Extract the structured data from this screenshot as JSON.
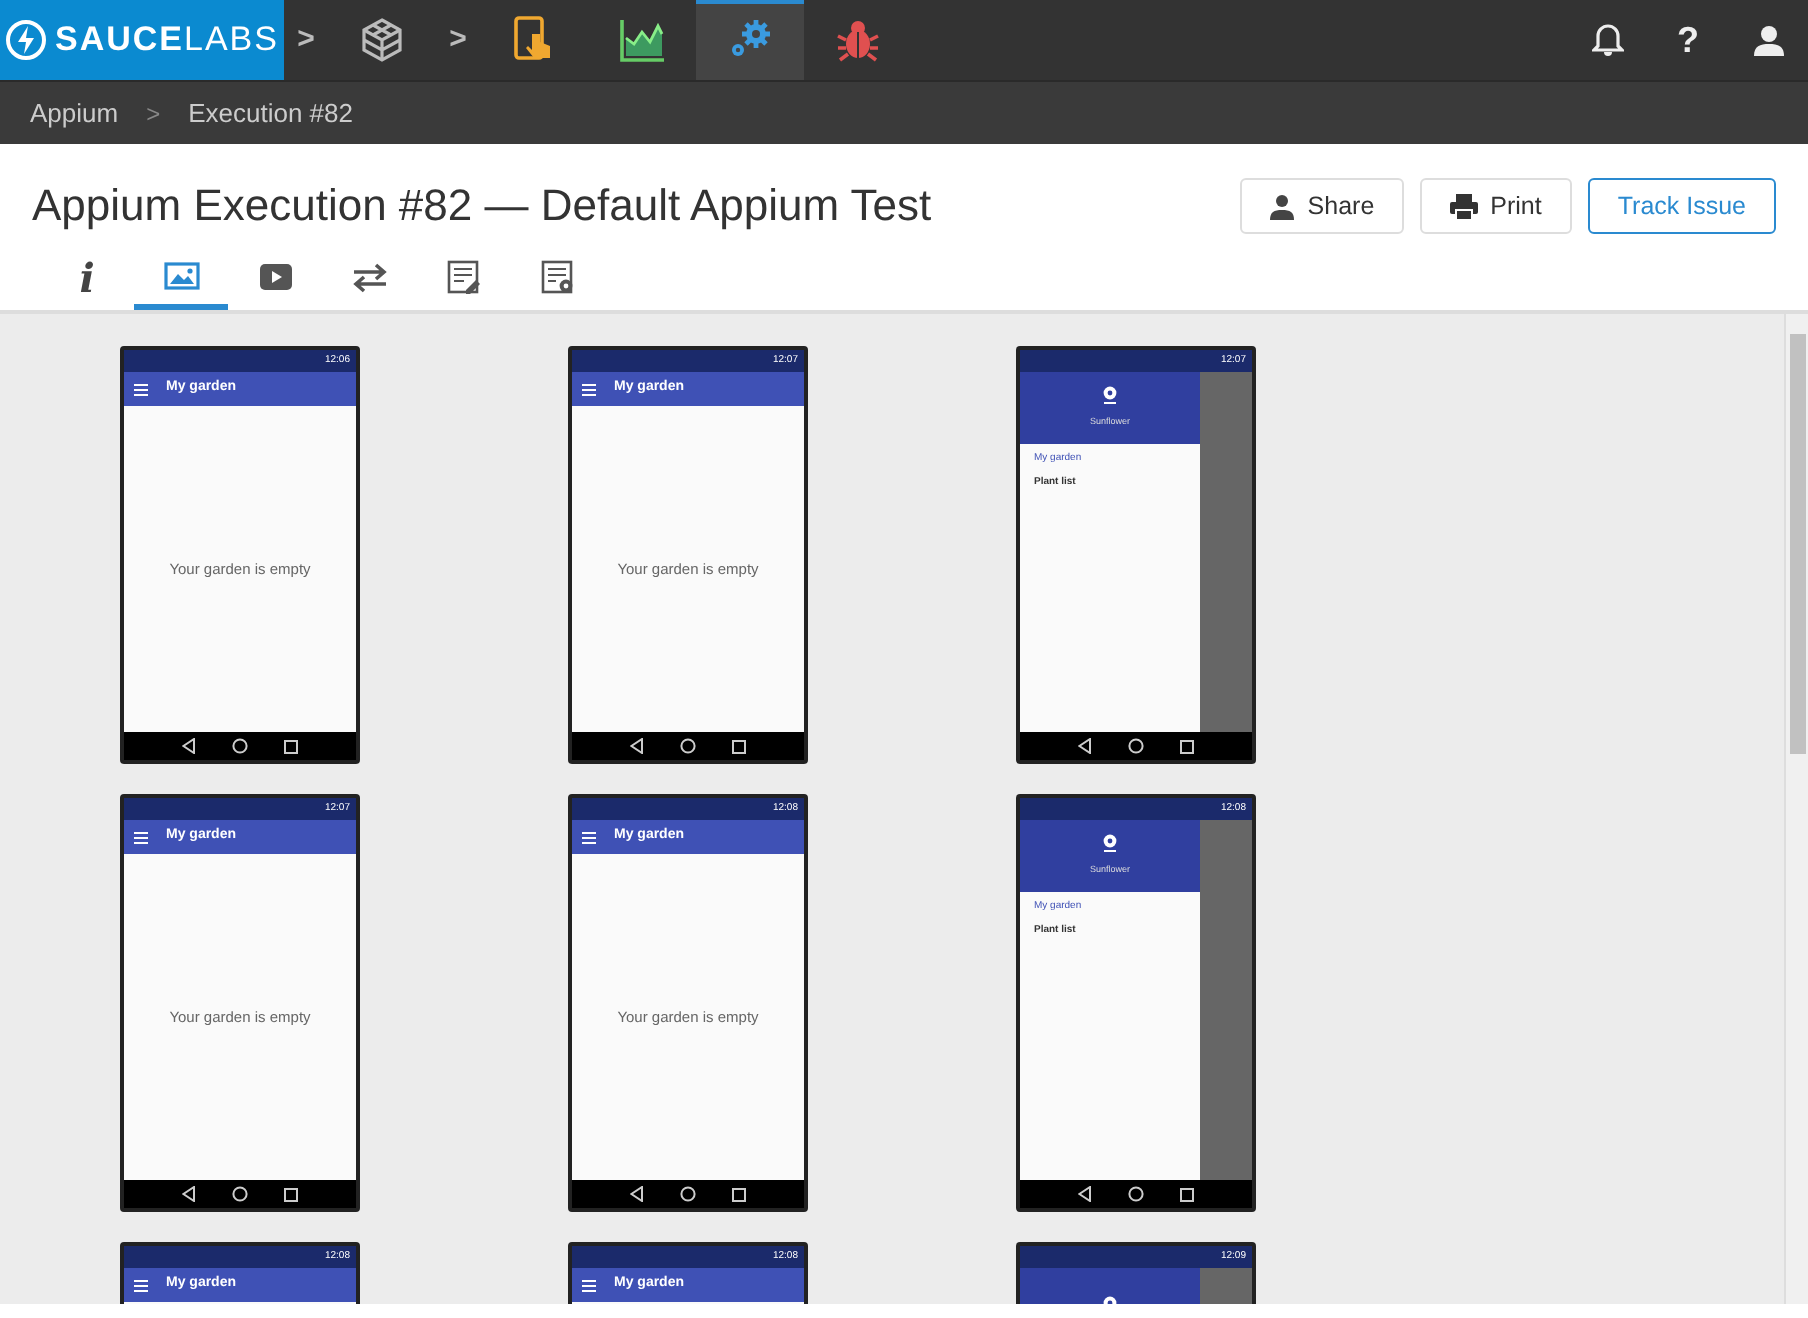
{
  "topbar": {
    "logo": "**SAUCE**LABS",
    "apps": [
      {
        "kind": "cube",
        "selected": false
      },
      {
        "kind": "tablet",
        "selected": false
      },
      {
        "kind": "chart",
        "selected": false
      },
      {
        "kind": "gears",
        "selected": true
      },
      {
        "kind": "bug",
        "selected": false
      }
    ],
    "separators": [
      ">",
      ">"
    ],
    "help_label": "?"
  },
  "breadcrumbs": {
    "items": [
      "Appium",
      "Execution #82"
    ],
    "separator": ">"
  },
  "header": {
    "title": "Appium Execution #82 — Default Appium Test",
    "buttons": [
      {
        "label": "Share",
        "kind": "share"
      },
      {
        "label": "Print",
        "kind": "print"
      },
      {
        "label": "Track Issue",
        "kind": "primary"
      }
    ]
  },
  "tabs": [
    {
      "kind": "info",
      "label": "i",
      "selected": false
    },
    {
      "kind": "image",
      "selected": true
    },
    {
      "kind": "video",
      "selected": false
    },
    {
      "kind": "arrows",
      "selected": false
    },
    {
      "kind": "log",
      "selected": false
    },
    {
      "kind": "metadata",
      "selected": false
    }
  ],
  "screenshots": [
    {
      "kind": "garden",
      "time": "12:06",
      "toolbar_title": "My garden",
      "body_text": "Your garden is empty"
    },
    {
      "kind": "garden",
      "time": "12:07",
      "toolbar_title": "My garden",
      "body_text": "Your garden is empty"
    },
    {
      "kind": "drawer",
      "time": "12:07",
      "app_name": "Sunflower",
      "menu": [
        {
          "label": "My garden",
          "selected": true
        },
        {
          "label": "Plant list",
          "selected": false
        }
      ]
    },
    {
      "kind": "garden",
      "time": "12:07",
      "toolbar_title": "My garden",
      "body_text": "Your garden is empty"
    },
    {
      "kind": "garden",
      "time": "12:08",
      "toolbar_title": "My garden",
      "body_text": "Your garden is empty"
    },
    {
      "kind": "drawer",
      "time": "12:08",
      "app_name": "Sunflower",
      "menu": [
        {
          "label": "My garden",
          "selected": true
        },
        {
          "label": "Plant list",
          "selected": false
        }
      ]
    },
    {
      "kind": "garden",
      "time": "12:08",
      "toolbar_title": "My garden"
    },
    {
      "kind": "garden",
      "time": "12:08",
      "toolbar_title": "My garden"
    },
    {
      "kind": "drawer",
      "time": "12:09"
    }
  ]
}
